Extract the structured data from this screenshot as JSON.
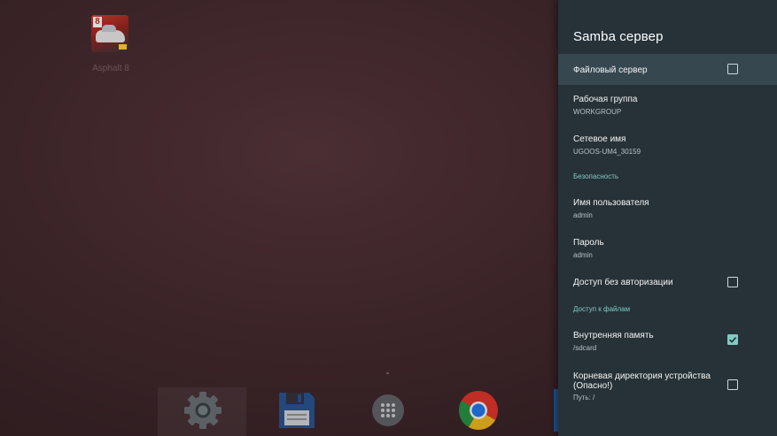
{
  "launcher": {
    "app": {
      "name": "Asphalt 8",
      "badge": "8"
    },
    "dock": [
      {
        "icon": "gear-icon"
      },
      {
        "icon": "floppy-disk-icon"
      },
      {
        "icon": "app-drawer-icon"
      },
      {
        "icon": "chrome-icon"
      }
    ]
  },
  "panel": {
    "title": "Samba сервер",
    "file_server": {
      "label": "Файловый сервер",
      "checked": false
    },
    "workgroup": {
      "label": "Рабочая группа",
      "value": "WORKGROUP"
    },
    "network_name": {
      "label": "Сетевое имя",
      "value": "UGOOS-UM4_30159"
    },
    "security_header": "Безопасность",
    "username": {
      "label": "Имя пользователя",
      "value": "admin"
    },
    "password": {
      "label": "Пароль",
      "value": "admin"
    },
    "anonymous_access": {
      "label": "Доступ без авторизации",
      "checked": false
    },
    "file_access_header": "Доступ к файлам",
    "internal_storage": {
      "label": "Внутренняя память",
      "value": "/sdcard",
      "checked": true
    },
    "root_dir": {
      "label_line1": "Корневая директория устройства",
      "label_line2": "(Опасно!)",
      "value": "Путь: /",
      "checked": false
    }
  },
  "colors": {
    "panel_bg": "#263238",
    "focused_row": "#37474f",
    "accent": "#80cbc4"
  }
}
